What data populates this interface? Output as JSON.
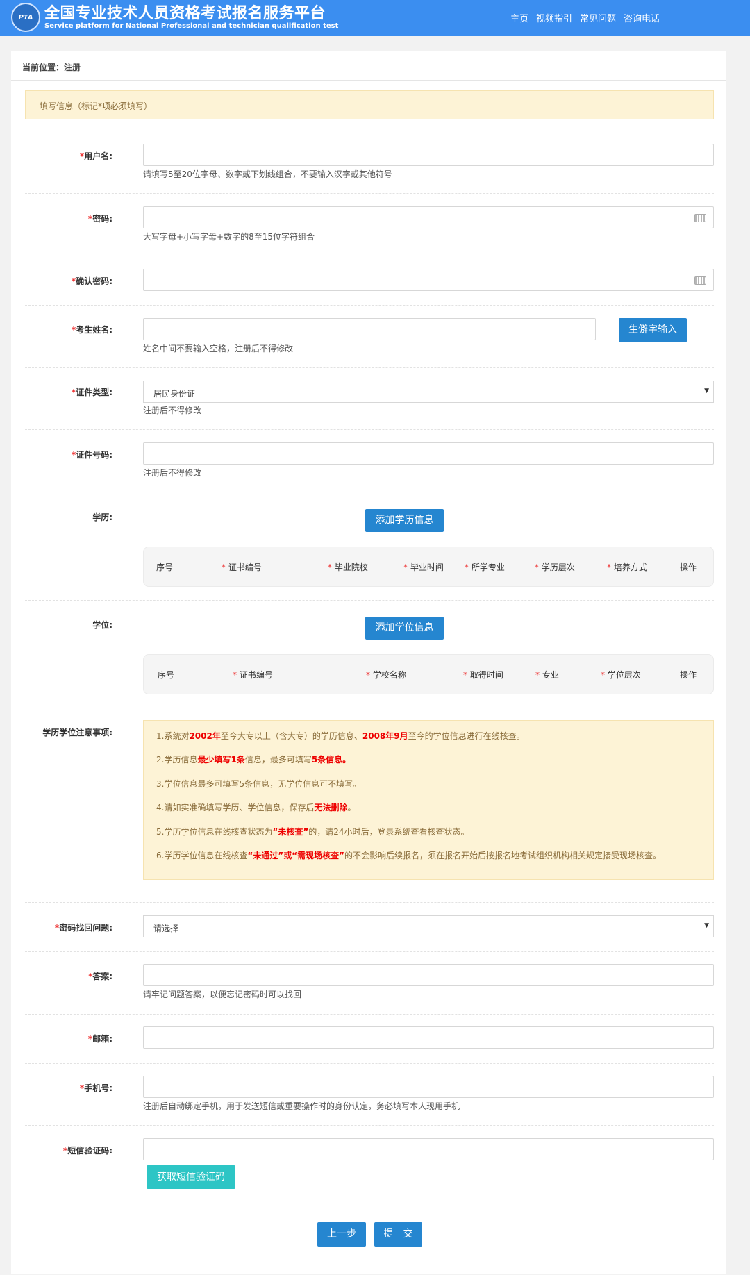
{
  "header": {
    "logo_text": "PTA",
    "title": "全国专业技术人员资格考试报名服务平台",
    "subtitle": "Service platform for National Professional and technician qualification test",
    "nav": [
      "主页",
      "视频指引",
      "常见问题",
      "咨询电话"
    ]
  },
  "breadcrumb": "当前位置：注册",
  "notice": "填写信息（标记*项必须填写）",
  "form": {
    "username": {
      "label": "用户名:",
      "hint": "请填写5至20位字母、数字或下划线组合，不要输入汉字或其他符号",
      "value": ""
    },
    "password": {
      "label": "密码:",
      "hint": "大写字母+小写字母+数字的8至15位字符组合",
      "value": ""
    },
    "confirm_password": {
      "label": "确认密码:",
      "value": ""
    },
    "name": {
      "label": "考生姓名:",
      "hint": "姓名中间不要输入空格，注册后不得修改",
      "rare_char_button": "生僻字输入",
      "value": ""
    },
    "id_type": {
      "label": "证件类型:",
      "value": "居民身份证",
      "hint": "注册后不得修改"
    },
    "id_number": {
      "label": "证件号码:",
      "hint": "注册后不得修改",
      "value": ""
    },
    "education": {
      "label": "学历:",
      "add_button": "添加学历信息",
      "columns": [
        "序号",
        "证书编号",
        "毕业院校",
        "毕业时间",
        "所学专业",
        "学历层次",
        "培养方式",
        "操作"
      ]
    },
    "degree": {
      "label": "学位:",
      "add_button": "添加学位信息",
      "columns": [
        "序号",
        "证书编号",
        "学校名称",
        "取得时间",
        "专业",
        "学位层次",
        "操作"
      ]
    },
    "notes": {
      "label": "学历学位注意事项:",
      "items": [
        [
          "1.系统对",
          "2002年",
          "至今大专以上（含大专）的学历信息、",
          "2008年9月",
          "至今的学位信息进行在线核查。"
        ],
        [
          "2.学历信息",
          "最少填写1条",
          "信息，最多可填写",
          "5条信息。",
          ""
        ],
        [
          "3.学位信息最多可填写5条信息，无学位信息可不填写。",
          "",
          "",
          "",
          ""
        ],
        [
          "4.请如实准确填写学历、学位信息，保存后",
          "无法删除",
          "。",
          "",
          ""
        ],
        [
          "5.学历学位信息在线核查状态为",
          "“未核查”",
          "的，请24小时后，登录系统查看核查状态。",
          "",
          ""
        ],
        [
          "6.学历学位信息在线核查",
          "“未通过”或“需现场核查”",
          "的不会影响后续报名，须在报名开始后按报名地考试组织机构相关规定接受现场核查。",
          "",
          ""
        ]
      ]
    },
    "security_question": {
      "label": "密码找回问题:",
      "value": "请选择"
    },
    "answer": {
      "label": "答案:",
      "hint": "请牢记问题答案，以便忘记密码时可以找回",
      "value": ""
    },
    "email": {
      "label": "邮箱:",
      "value": ""
    },
    "phone": {
      "label": "手机号:",
      "hint": "注册后自动绑定手机，用于发送短信或重要操作时的身份认定，务必填写本人现用手机",
      "value": ""
    },
    "sms_code": {
      "label": "短信验证码:",
      "send_button": "获取短信验证码",
      "value": ""
    }
  },
  "actions": {
    "prev": "上一步",
    "submit": "提　交"
  },
  "colors": {
    "header": "#3b8ef0",
    "button": "#2586d0",
    "teal_button": "#2dc5c5",
    "notice_bg": "#fdf3d6",
    "required": "#e33"
  }
}
